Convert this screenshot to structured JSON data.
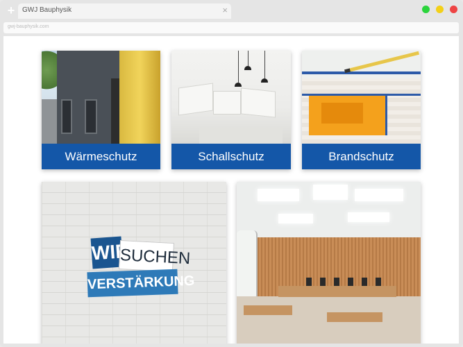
{
  "browser": {
    "tab_title": "GWJ Bauphysik",
    "address": "gwj-bauphysik.com",
    "new_tab_symbol": "+",
    "close_symbol": "×"
  },
  "cards": [
    {
      "label": "Wärmeschutz"
    },
    {
      "label": "Schallschutz"
    },
    {
      "label": "Brandschutz"
    },
    {
      "banner": {
        "line1_left": "WIR",
        "line1_right": "SUCHEN",
        "line2": "VERSTÄRKUNG"
      }
    },
    {
      "label": ""
    }
  ],
  "colors": {
    "caption_blue": "#1457a8",
    "traffic_green": "#2bd43c",
    "traffic_yellow": "#f3d018",
    "traffic_red": "#ee4444"
  }
}
